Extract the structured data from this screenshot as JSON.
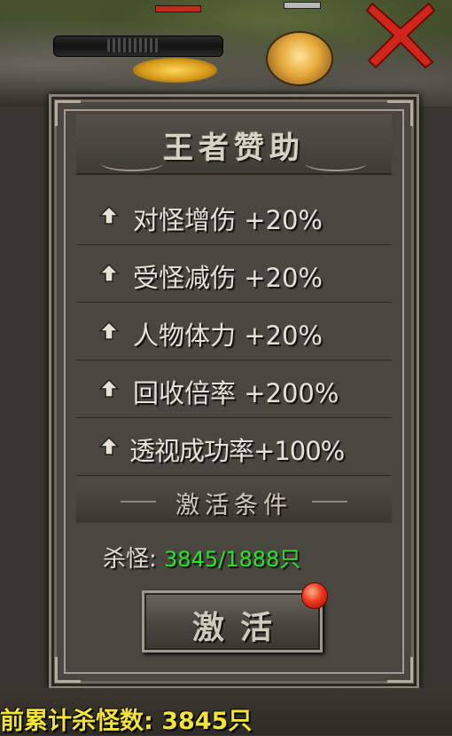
{
  "panel": {
    "title": "王者赞助",
    "bonuses": [
      {
        "icon": "up-arrow-icon",
        "text": "对怪增伤 +20%"
      },
      {
        "icon": "up-arrow-icon",
        "text": "受怪减伤 +20%"
      },
      {
        "icon": "up-arrow-icon",
        "text": "人物体力 +20%"
      },
      {
        "icon": "up-arrow-icon",
        "text": "回收倍率 +200%"
      },
      {
        "icon": "up-arrow-icon",
        "text": "透视成功率+100%"
      }
    ],
    "condition_title": "激活条件",
    "kill_label": "杀怪:",
    "kill_value": "3845/1888只",
    "activate_label": "激活"
  },
  "footer": {
    "text": "前累计杀怪数: 3845只"
  },
  "colors": {
    "kill_value": "#27e32a",
    "footer_text": "#f2e23c",
    "close_x": "#d1241a"
  }
}
